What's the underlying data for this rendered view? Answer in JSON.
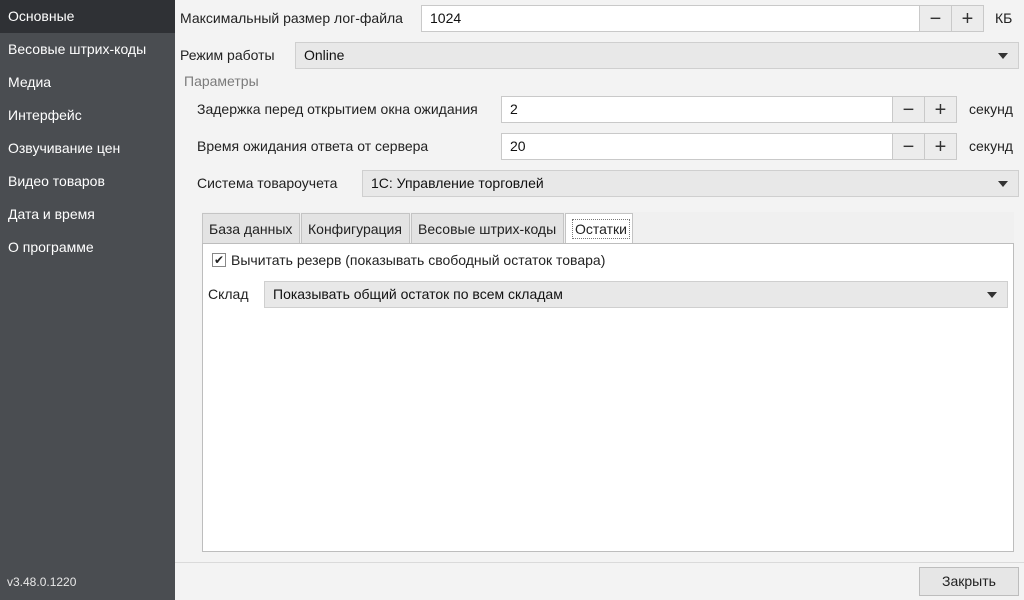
{
  "sidebar": {
    "items": [
      {
        "label": "Основные"
      },
      {
        "label": "Весовые штрих-коды"
      },
      {
        "label": "Медиа"
      },
      {
        "label": "Интерфейс"
      },
      {
        "label": "Озвучивание цен"
      },
      {
        "label": "Видео товаров"
      },
      {
        "label": "Дата и время"
      },
      {
        "label": "О программе"
      }
    ],
    "active_index": 0,
    "version": "v3.48.0.1220"
  },
  "main": {
    "log_size": {
      "label": "Максимальный размер лог-файла",
      "value": "1024",
      "unit": "КБ",
      "minus": "−",
      "plus": "+"
    },
    "mode": {
      "label": "Режим работы",
      "value": "Online"
    },
    "params_title": "Параметры",
    "wait_delay": {
      "label": "Задержка перед открытием окна ожидания",
      "value": "2",
      "unit": "секунд",
      "minus": "−",
      "plus": "+"
    },
    "server_timeout": {
      "label": "Время ожидания ответа от сервера",
      "value": "20",
      "unit": "секунд",
      "minus": "−",
      "plus": "+"
    },
    "accounting": {
      "label": "Система товароучета",
      "value": "1С: Управление торговлей"
    },
    "tabs": [
      {
        "label": "База данных"
      },
      {
        "label": "Конфигурация"
      },
      {
        "label": "Весовые штрих-коды"
      },
      {
        "label": "Остатки"
      }
    ],
    "active_tab": 3,
    "stock": {
      "reserve_checkbox": {
        "label": "Вычитать резерв (показывать свободный остаток товара)",
        "checked": true,
        "mark": "✔"
      },
      "warehouse": {
        "label": "Склад",
        "value": "Показывать общий остаток по всем складам"
      }
    },
    "close_button": "Закрыть"
  }
}
